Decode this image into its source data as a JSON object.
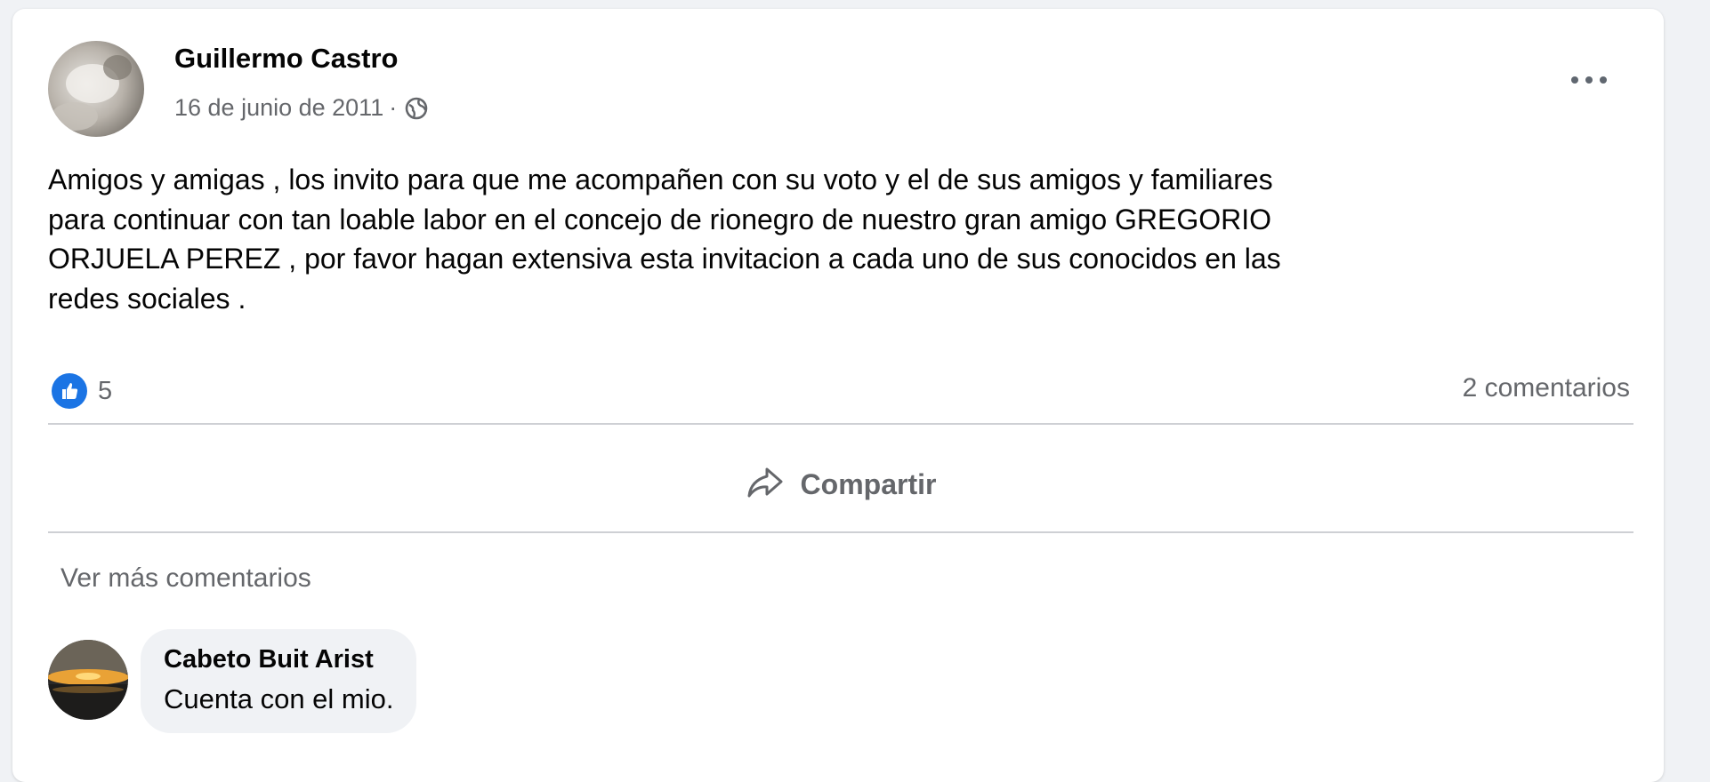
{
  "post": {
    "author": "Guillermo Castro",
    "date": "16 de junio de 2011",
    "separator": "·",
    "privacy_icon": "globe-icon",
    "more_icon": "more-horizontal-icon",
    "text": "Amigos  y amigas , los invito para que me acompañen con su voto y el de sus amigos y familiares\npara continuar con tan loable labor en el concejo de rionegro de nuestro gran amigo GREGORIO\nORJUELA PEREZ , por favor hagan extensiva esta invitacion a cada  uno de sus conocidos en  las\nredes sociales ."
  },
  "stats": {
    "reaction_icon": "like-icon",
    "reaction_count": "5",
    "comments_label": "2 comentarios"
  },
  "actions": {
    "share_icon": "share-icon",
    "share_label": "Compartir"
  },
  "comments": {
    "view_more_label": "Ver más comentarios",
    "items": [
      {
        "author": "Cabeto Buit Arist",
        "text": "Cuenta con el mio."
      }
    ]
  },
  "colors": {
    "accent": "#1b74e4",
    "secondary_text": "#65676b",
    "bubble": "#f0f2f5"
  }
}
